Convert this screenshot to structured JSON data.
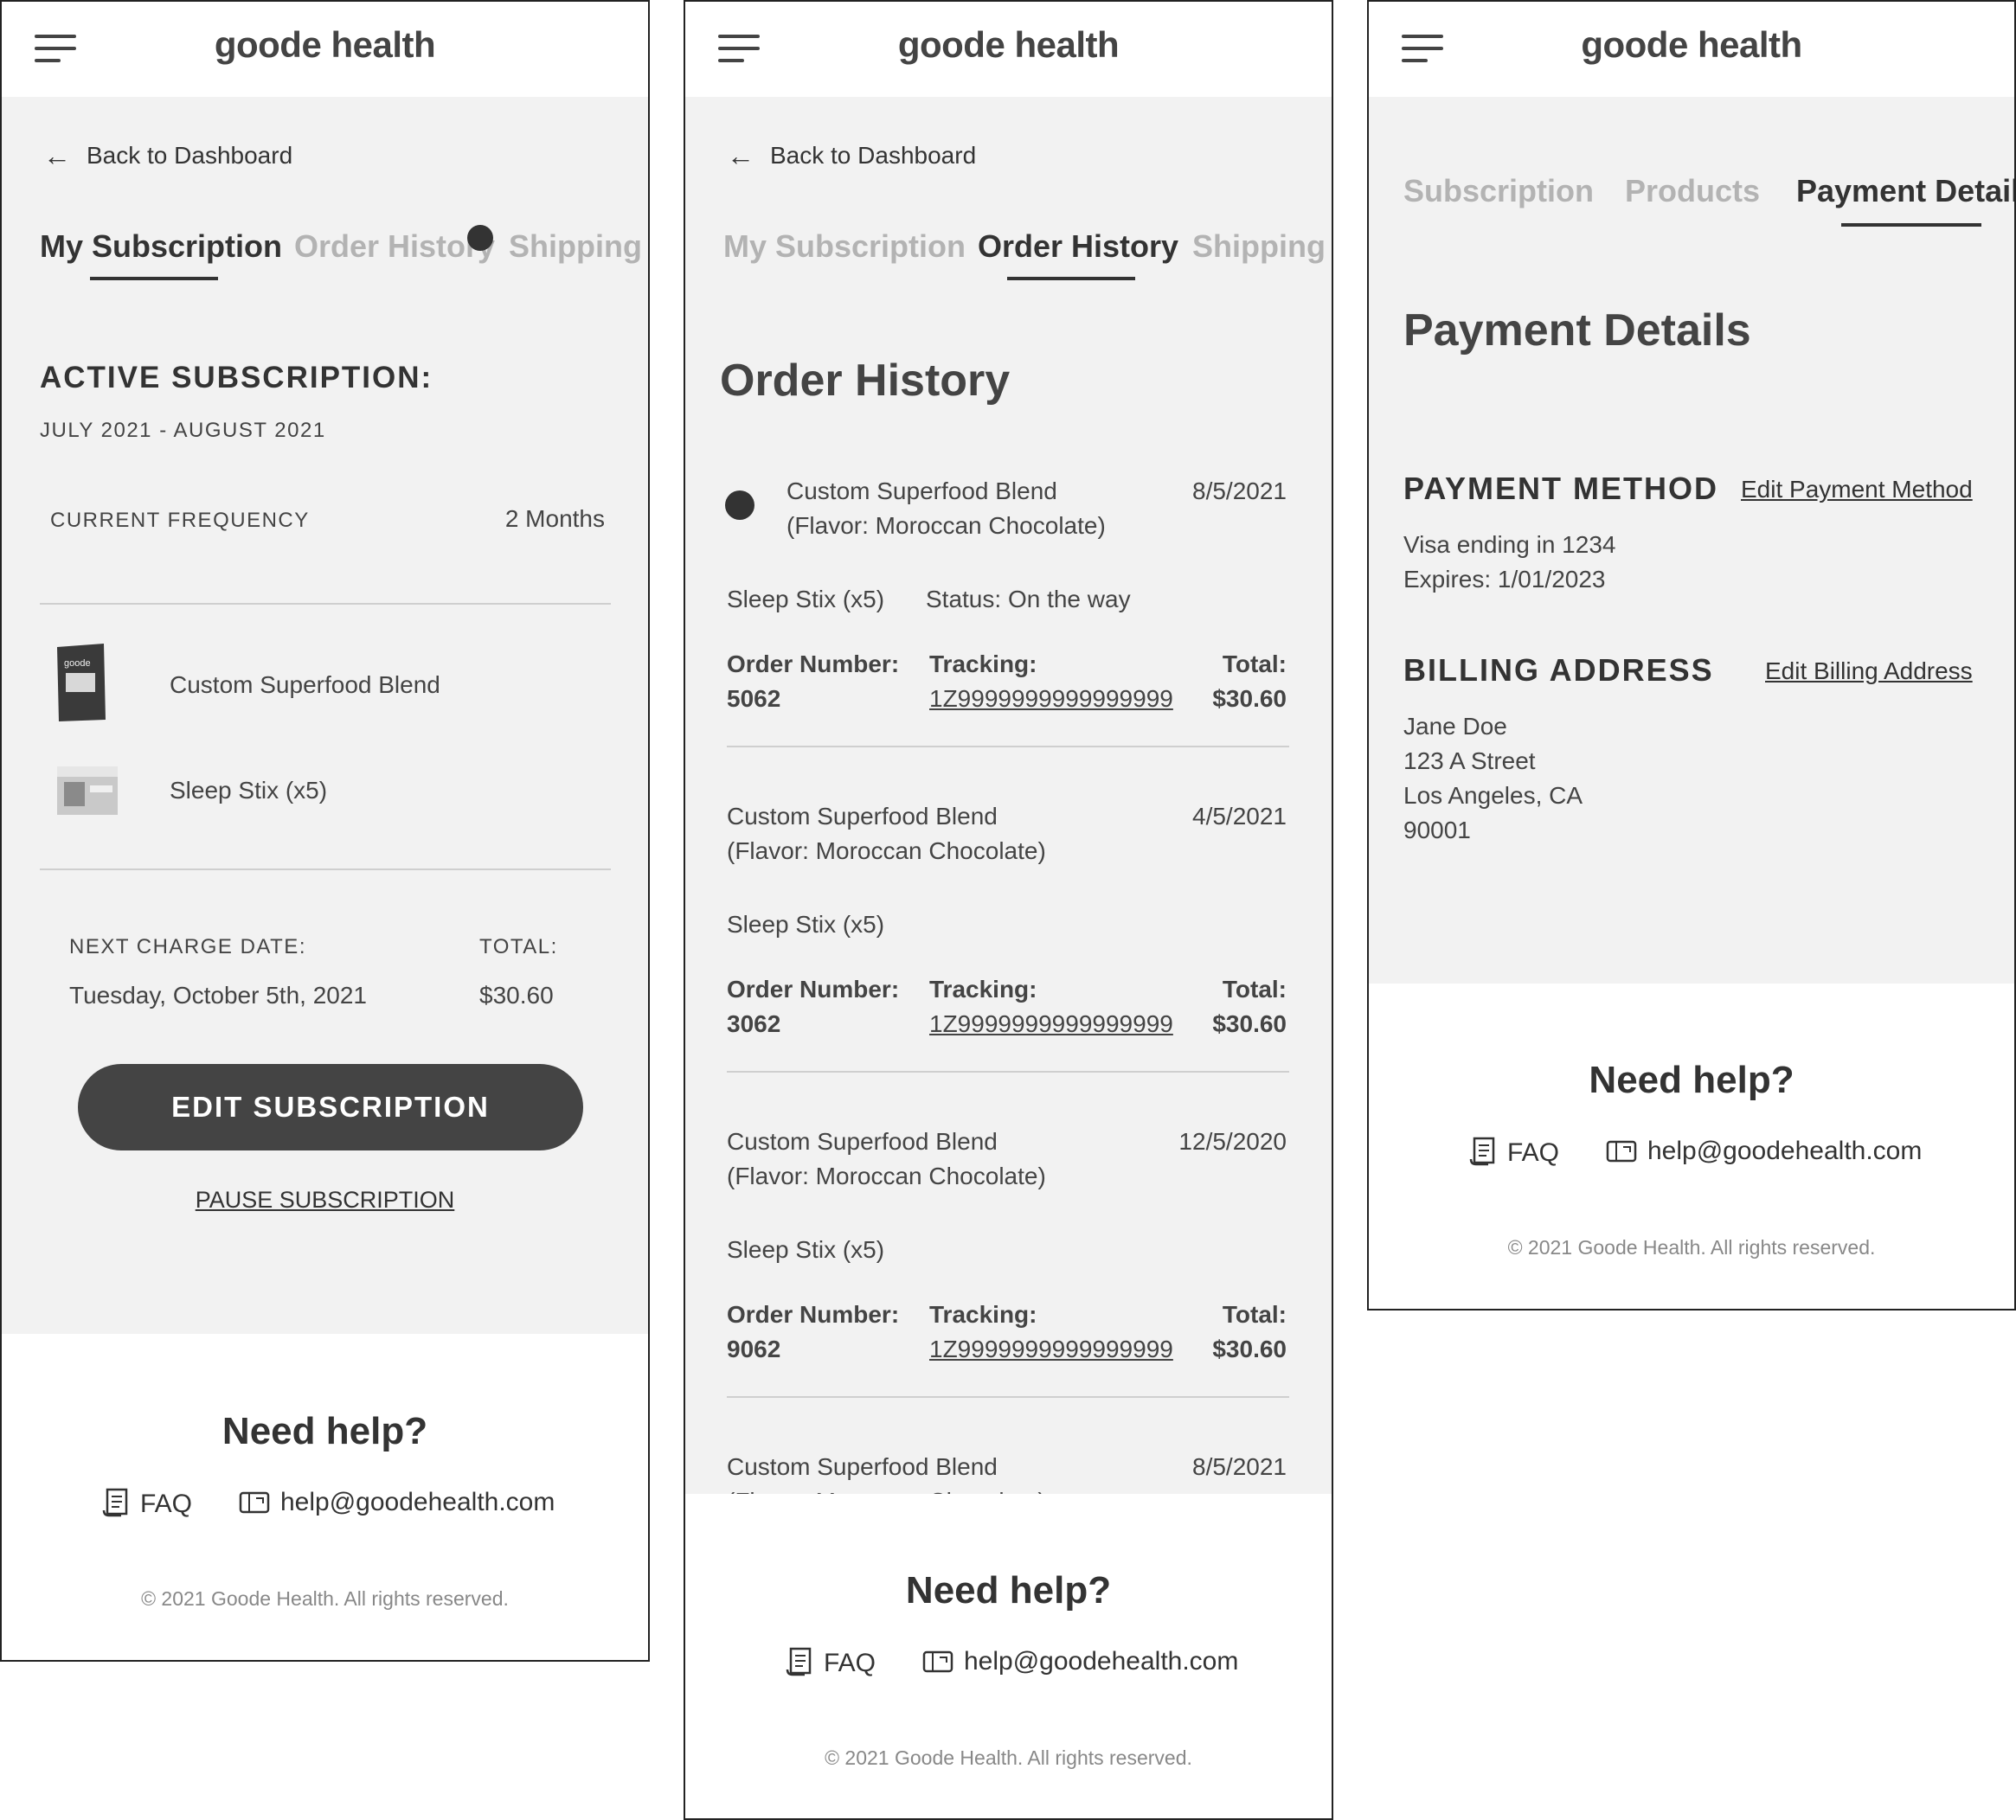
{
  "brand": {
    "logo": "goode health"
  },
  "nav": {
    "back_label": "Back to Dashboard"
  },
  "screen1": {
    "tabs": [
      "My Subscription",
      "Order History",
      "Shipping a"
    ],
    "active_heading": "ACTIVE SUBSCRIPTION:",
    "period": "JULY 2021 - AUGUST 2021",
    "frequency_label": "CURRENT FREQUENCY",
    "frequency_value": "2 Months",
    "products": [
      {
        "name": "Custom Superfood Blend",
        "icon": "coffee-bag-image"
      },
      {
        "name": "Sleep Stix (x5)",
        "icon": "box-image"
      }
    ],
    "next_charge_label": "NEXT CHARGE DATE:",
    "next_charge_value": "Tuesday, October 5th, 2021",
    "total_label": "TOTAL:",
    "total_value": "$30.60",
    "edit_button": "EDIT SUBSCRIPTION",
    "pause_link": "PAUSE SUBSCRIPTION"
  },
  "screen2": {
    "tabs": [
      "My Subscription",
      "Order History",
      "Shipping a"
    ],
    "heading": "Order History",
    "orders": [
      {
        "product": "Custom Superfood Blend",
        "flavor": "(Flavor: Moroccan Chocolate)",
        "date": "8/5/2021",
        "item2": "Sleep Stix (x5)",
        "status": "Status: On the way",
        "order_label": "Order Number:",
        "order_number": "5062",
        "tracking_label": "Tracking:",
        "tracking": "1Z9999999999999999",
        "total_label": "Total:",
        "total": "$30.60"
      },
      {
        "product": "Custom Superfood Blend",
        "flavor": "(Flavor: Moroccan Chocolate)",
        "date": "4/5/2021",
        "item2": "Sleep Stix (x5)",
        "status": "",
        "order_label": "Order Number:",
        "order_number": "3062",
        "tracking_label": "Tracking:",
        "tracking": "1Z9999999999999999",
        "total_label": "Total:",
        "total": "$30.60"
      },
      {
        "product": "Custom Superfood Blend",
        "flavor": "(Flavor: Moroccan Chocolate)",
        "date": "12/5/2020",
        "item2": "Sleep Stix (x5)",
        "status": "",
        "order_label": "Order Number:",
        "order_number": "9062",
        "tracking_label": "Tracking:",
        "tracking": "1Z9999999999999999",
        "total_label": "Total:",
        "total": "$30.60"
      },
      {
        "product": "Custom Superfood Blend",
        "flavor": "(Flavor: Moroccan Chocolate)",
        "date": "8/5/2021"
      }
    ]
  },
  "screen3": {
    "tabs": [
      "Subscription",
      "Products",
      "Payment Details"
    ],
    "heading": "Payment Details",
    "payment_method_label": "PAYMENT METHOD",
    "edit_payment": "Edit Payment Method",
    "card_line": "Visa ending in 1234",
    "expires_line": "Expires: 1/01/2023",
    "billing_label": "BILLING ADDRESS",
    "edit_billing": "Edit Billing Address",
    "address": [
      "Jane Doe",
      "123 A Street",
      "Los Angeles, CA",
      "90001"
    ]
  },
  "footer": {
    "help_title": "Need help?",
    "faq": "FAQ",
    "email": "help@goodehealth.com",
    "copyright": "© 2021 Goode Health. All rights reserved."
  }
}
